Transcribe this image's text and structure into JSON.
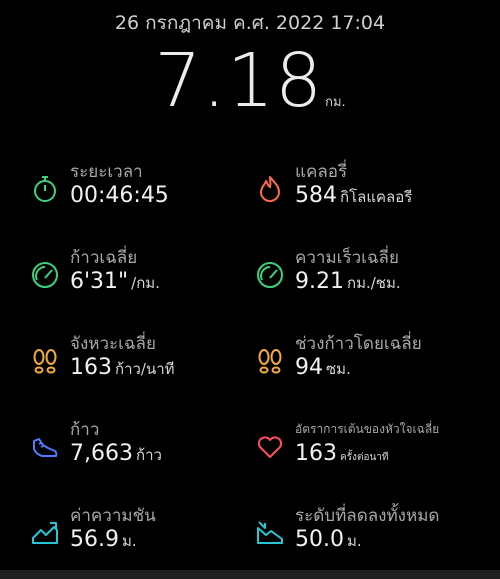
{
  "header": {
    "date": "26 กรกฎาคม ค.ศ. 2022 17:04",
    "distance_value": "7.18",
    "distance_unit": "กม."
  },
  "stats": [
    {
      "id": "duration",
      "label": "ระยะเวลา",
      "value": "00:46:45",
      "unit": "",
      "icon": "stopwatch-icon",
      "color": "#3ad27e"
    },
    {
      "id": "calories",
      "label": "แคลอรี่",
      "value": "584",
      "unit": "กิโลแคลอรี",
      "icon": "flame-icon",
      "color": "#ff6a4d"
    },
    {
      "id": "avg-pace",
      "label": "ก้าวเฉลี่ย",
      "value": "6'31\"",
      "unit": "/กม.",
      "icon": "speedometer-icon",
      "color": "#3ad27e"
    },
    {
      "id": "avg-speed",
      "label": "ความเร็วเฉลี่ย",
      "value": "9.21",
      "unit": "กม./ชม.",
      "icon": "speedometer-icon",
      "color": "#3ad27e"
    },
    {
      "id": "avg-cadence",
      "label": "จังหวะเฉลี่ย",
      "value": "163",
      "unit": "ก้าว/นาที",
      "icon": "footprints-icon",
      "color": "#f2a93b"
    },
    {
      "id": "avg-stride",
      "label": "ช่วงก้าวโดยเฉลี่ย",
      "value": "94",
      "unit": "ซม.",
      "icon": "footprints-icon",
      "color": "#f2a93b"
    },
    {
      "id": "steps",
      "label": "ก้าว",
      "value": "7,663",
      "unit": "ก้าว",
      "icon": "shoe-icon",
      "color": "#4f7dff"
    },
    {
      "id": "avg-heart-rate",
      "label": "อัตราการเต้นของหัวใจเฉลี่ย",
      "value": "163",
      "unit": "ครั้งต่อนาที",
      "icon": "heart-icon",
      "color": "#ff4d5e"
    },
    {
      "id": "elevation-gain",
      "label": "ค่าความชัน",
      "value": "56.9",
      "unit": "ม.",
      "icon": "uphill-icon",
      "color": "#25c6d6"
    },
    {
      "id": "total-descent",
      "label": "ระดับที่ลดลงทั้งหมด",
      "value": "50.0",
      "unit": "ม.",
      "icon": "downhill-icon",
      "color": "#25c6d6"
    }
  ]
}
